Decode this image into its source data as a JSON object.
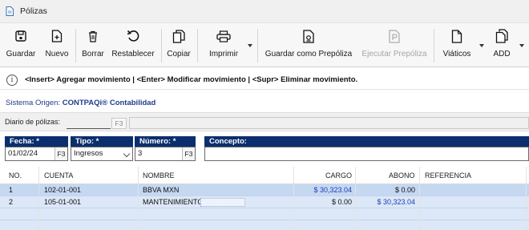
{
  "window": {
    "title": "Pólizas"
  },
  "toolbar": {
    "guardar": "Guardar",
    "nuevo": "Nuevo",
    "borrar": "Borrar",
    "restablecer": "Restablecer",
    "copiar": "Copiar",
    "imprimir": "Imprimir",
    "guardar_prepoliza": "Guardar como Prepóliza",
    "ejecutar_prepoliza": "Ejecutar Prepóliza",
    "viaticos": "Viáticos",
    "add": "ADD"
  },
  "info": {
    "message": "<Insert> Agregar movimiento | <Enter> Modificar movimiento | <Supr> Eliminar movimiento."
  },
  "origin": {
    "label": "Sistema Origen:",
    "value": "CONTPAQi® Contabilidad"
  },
  "diario": {
    "label": "Diario de pólizas:",
    "f3": "F3"
  },
  "fields": {
    "fecha": {
      "label": "Fecha: *",
      "value": "01/02/24",
      "f3": "F3"
    },
    "tipo": {
      "label": "Tipo: *",
      "value": "Ingresos"
    },
    "numero": {
      "label": "Número: *",
      "value": "3",
      "f3": "F3"
    },
    "concepto": {
      "label": "Concepto:",
      "value": ""
    }
  },
  "grid": {
    "columns": [
      "NO.",
      "CUENTA",
      "NOMBRE",
      "CARGO",
      "ABONO",
      "REFERENCIA"
    ],
    "rows": [
      {
        "no": "1",
        "cuenta": "102-01-001",
        "nombre": "BBVA MXN",
        "cargo": "$ 30,323.04",
        "abono": "$ 0.00",
        "referencia": ""
      },
      {
        "no": "2",
        "cuenta": "105-01-001",
        "nombre": "MANTENIMIENTO",
        "cargo": "$ 0.00",
        "abono": "$ 30,323.04",
        "referencia": ""
      }
    ]
  },
  "colors": {
    "header_navy": "#0b2f6e",
    "selected_row": "#c5d8f2",
    "amount_blue": "#1b3fb8",
    "origin_blue": "#1f3c8c"
  }
}
